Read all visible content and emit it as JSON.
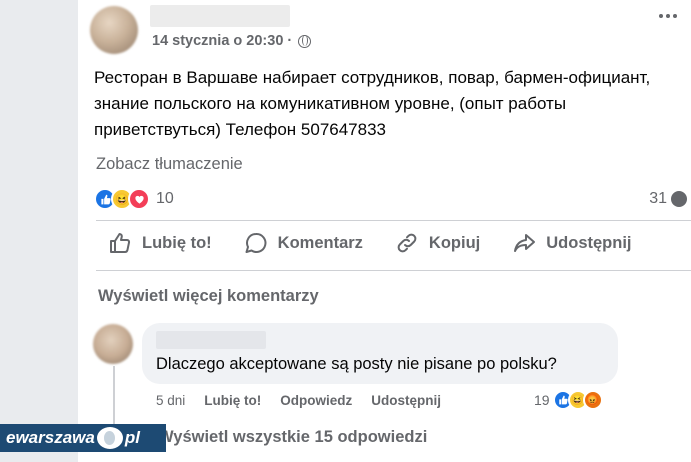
{
  "post": {
    "timestamp": "14 stycznia o 20:30",
    "privacy_icon": "globe-icon",
    "text": "Ресторан в Варшаве набирает сотрудников, повар, бармен-официант, знание польского на комуникативном уровне, (опыт работы приветствуться)  Телефон 507647833",
    "translate_link": "Zobacz tłumaczenie",
    "reaction_count": "10",
    "reaction_icons": [
      "like-icon",
      "haha-icon",
      "love-icon"
    ],
    "comment_count": "31"
  },
  "actions": {
    "like": "Lubię to!",
    "comment": "Komentarz",
    "copy": "Kopiuj",
    "share": "Udostępnij"
  },
  "comments": {
    "view_more": "Wyświetl więcej komentarzy",
    "items": [
      {
        "text": "Dlaczego akceptowane są posty nie pisane po polsku?",
        "age": "5 dni",
        "like": "Lubię to!",
        "reply": "Odpowiedz",
        "share": "Udostępnij",
        "reaction_count": "19",
        "reaction_icons": [
          "like-icon",
          "haha-icon",
          "angry-icon"
        ]
      }
    ],
    "view_all_replies": "Wyświetl wszystkie 15 odpowiedzi"
  },
  "watermark": {
    "left": "ewarszawa",
    "right": "pl"
  },
  "colors": {
    "like_blue": "#1b74e4",
    "secondary_text": "#65676b",
    "bubble_bg": "#f0f2f5",
    "watermark_bg": "#1d4a73"
  }
}
